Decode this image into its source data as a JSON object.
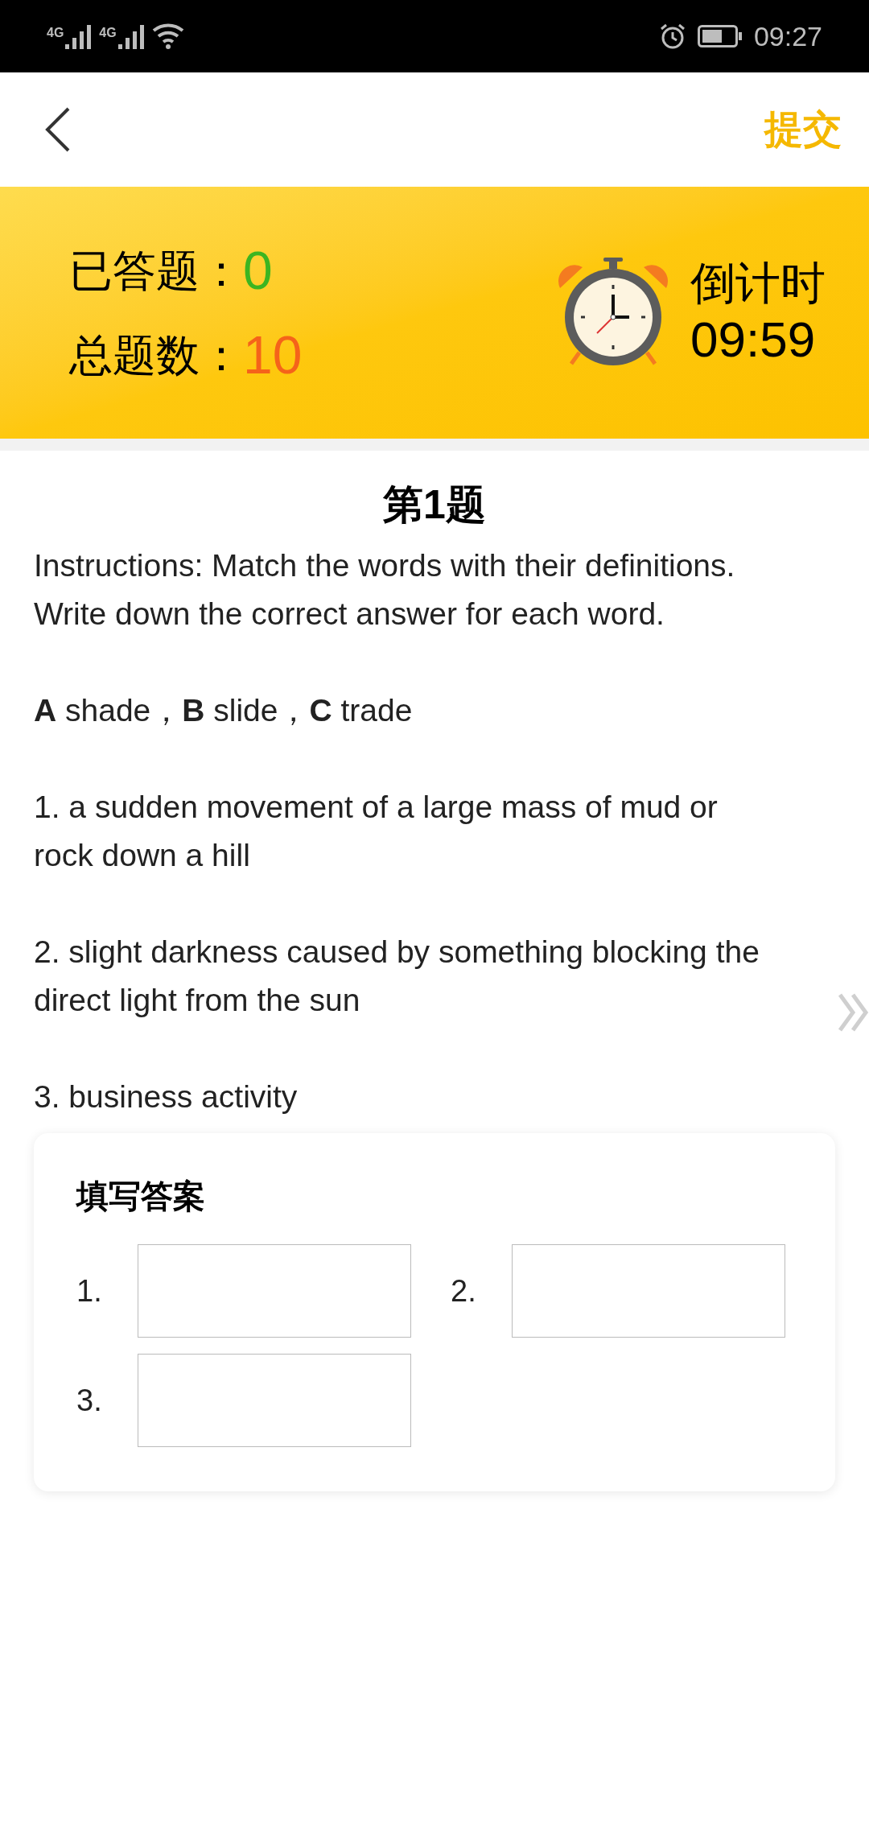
{
  "status_bar": {
    "network_labels": [
      "4G",
      "4G"
    ],
    "time": "09:27"
  },
  "header": {
    "submit": "提交"
  },
  "summary": {
    "answered_label": "已答题：",
    "answered": "0",
    "total_label": "总题数：",
    "total": "10",
    "countdown_label": "倒计时",
    "countdown": "09:59"
  },
  "question": {
    "title": "第1题",
    "paragraphs": [
      [
        "Instructions: Match the words with their definitions.",
        "Write down the correct answer for each word."
      ],
      [
        "**A** shade，**B** slide，**C** trade"
      ],
      [
        "1. a sudden movement of a large mass of mud or",
        "rock down a hill"
      ],
      [
        "2. slight darkness caused by something blocking the",
        "direct light from the sun"
      ],
      [
        "3. business activity"
      ]
    ]
  },
  "answer_card": {
    "title": "填写答案",
    "answers": [
      {
        "label": "1."
      },
      {
        "label": "2."
      },
      {
        "label": "3."
      }
    ]
  }
}
